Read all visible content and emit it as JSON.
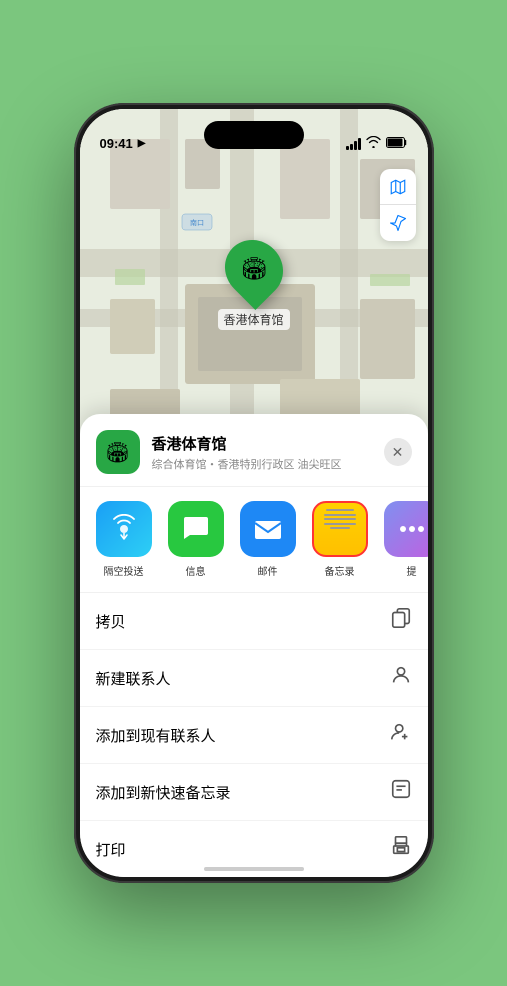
{
  "statusBar": {
    "time": "09:41",
    "locationIcon": "▶"
  },
  "mapControls": {
    "mapIcon": "🗺",
    "locationIcon": "➤"
  },
  "locationPin": {
    "label": "香港体育馆"
  },
  "mapLabel": {
    "text": "南口"
  },
  "sheetHeader": {
    "venueName": "香港体育馆",
    "venueSub": "综合体育馆・香港特别行政区 油尖旺区",
    "closeLabel": "✕"
  },
  "shareActions": [
    {
      "id": "airdrop",
      "label": "隔空投送",
      "icon": "airdrop"
    },
    {
      "id": "messages",
      "label": "信息",
      "icon": "messages"
    },
    {
      "id": "mail",
      "label": "邮件",
      "icon": "mail"
    },
    {
      "id": "notes",
      "label": "备忘录",
      "icon": "notes"
    },
    {
      "id": "more",
      "label": "提",
      "icon": "more"
    }
  ],
  "menuItems": [
    {
      "label": "拷贝",
      "icon": "copy"
    },
    {
      "label": "新建联系人",
      "icon": "contact-new"
    },
    {
      "label": "添加到现有联系人",
      "icon": "contact-add"
    },
    {
      "label": "添加到新快速备忘录",
      "icon": "quick-note"
    },
    {
      "label": "打印",
      "icon": "print"
    }
  ],
  "colors": {
    "pinGreen": "#28a745",
    "accentBlue": "#007AFF",
    "sheetBg": "#ffffff",
    "notesYellow": "#FFD100",
    "notesBorder": "#ff3333"
  }
}
